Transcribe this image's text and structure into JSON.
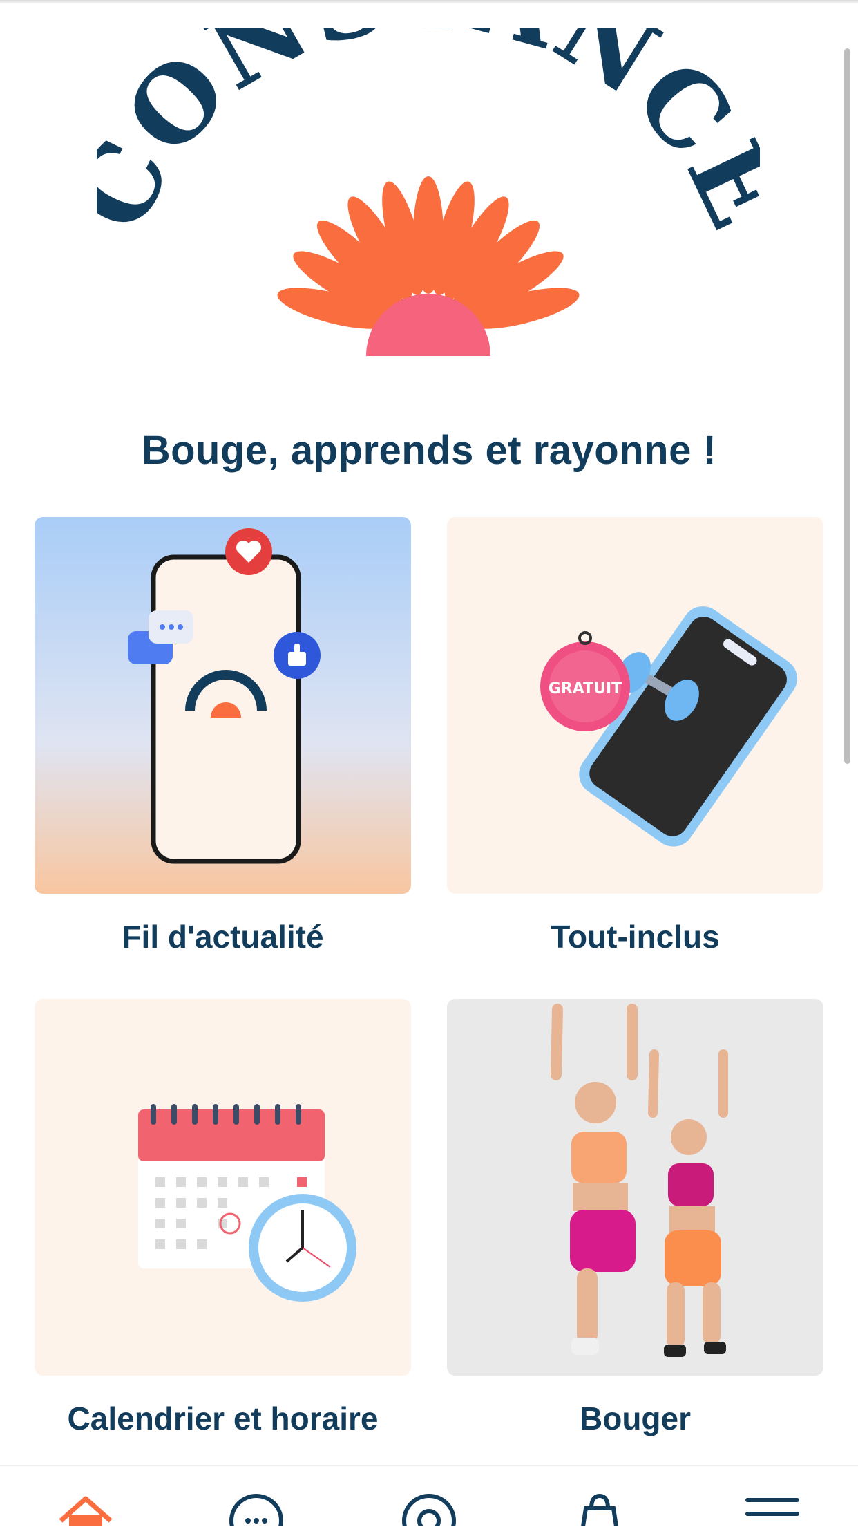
{
  "brand": {
    "name": "CONSTANCE",
    "colors": {
      "navy": "#123c5c",
      "orange": "#f96d3f",
      "pink": "#f6637c",
      "cream": "#fdf3ea"
    }
  },
  "header": {
    "tagline": "Bouge, apprends et rayonne !"
  },
  "cards": [
    {
      "label": "Fil d'actualité",
      "image": "phone-social-illustration"
    },
    {
      "label": "Tout-inclus",
      "image": "phone-dumbbell-gratuit-illustration",
      "badge": "GRATUIT"
    },
    {
      "label": "Calendrier et horaire",
      "image": "calendar-clock-illustration"
    },
    {
      "label": "Bouger",
      "image": "two-women-exercising-photo"
    }
  ],
  "bottom_nav": [
    {
      "icon": "home-icon",
      "active": true
    },
    {
      "icon": "chat-icon",
      "active": false
    },
    {
      "icon": "target-icon",
      "active": false
    },
    {
      "icon": "shopping-bag-icon",
      "active": false
    },
    {
      "icon": "menu-icon",
      "active": false
    }
  ]
}
